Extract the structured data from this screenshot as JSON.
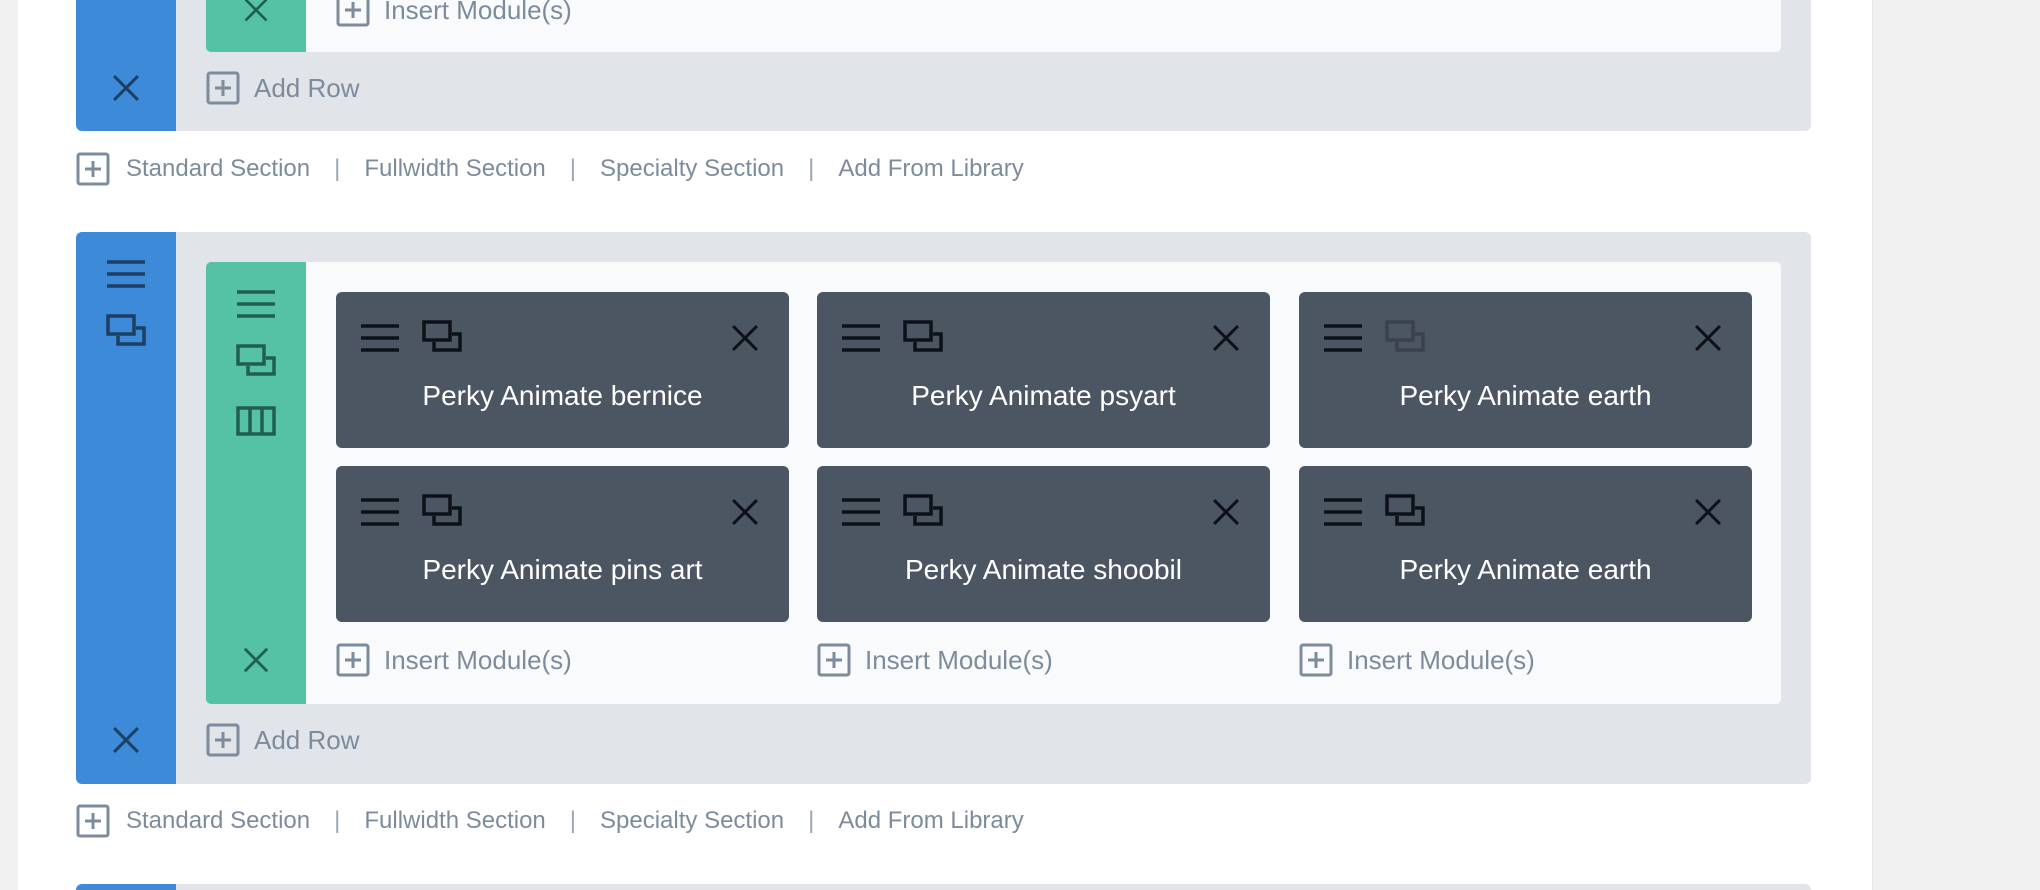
{
  "colors": {
    "section_rail": "#3d8ad8",
    "row_rail": "#55c2a6",
    "section_bg": "#e1e4e9",
    "row_bg": "#f8fafb",
    "module_bg": "#4c5562",
    "link_text": "#7c8c9c"
  },
  "icons": {
    "menu": "hamburger-icon",
    "duplicate": "duplicate-icon",
    "columns": "columns-icon",
    "close": "close-icon",
    "add": "plus-square-icon"
  },
  "top_section": {
    "insert_label": "Insert Module(s)",
    "add_row_label": "Add Row"
  },
  "section_links": {
    "standard": "Standard Section",
    "fullwidth": "Fullwidth Section",
    "specialty": "Specialty Section",
    "library": "Add From Library",
    "separator": "|"
  },
  "main_section": {
    "modules": [
      {
        "title": "Perky Animate bernice"
      },
      {
        "title": "Perky Animate psyart"
      },
      {
        "title": "Perky Animate earth"
      },
      {
        "title": "Perky Animate pins art"
      },
      {
        "title": "Perky Animate shoobil"
      },
      {
        "title": "Perky Animate earth"
      }
    ],
    "insert_labels": [
      "Insert Module(s)",
      "Insert Module(s)",
      "Insert Module(s)"
    ],
    "add_row_label": "Add Row"
  }
}
